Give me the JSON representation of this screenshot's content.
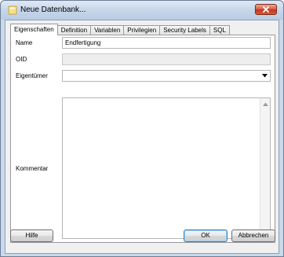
{
  "window": {
    "title": "Neue Datenbank...",
    "close_icon": "close-x-icon"
  },
  "tabs": [
    {
      "label": "Eigenschaften",
      "active": true
    },
    {
      "label": "Definition",
      "active": false
    },
    {
      "label": "Variablen",
      "active": false
    },
    {
      "label": "Privilegien",
      "active": false
    },
    {
      "label": "Security Labels",
      "active": false
    },
    {
      "label": "SQL",
      "active": false
    }
  ],
  "form": {
    "name_label": "Name",
    "name_value": "Endfertigung",
    "oid_label": "OID",
    "oid_value": "",
    "owner_label": "Eigentümer",
    "owner_value": "",
    "comment_label": "Kommentar",
    "comment_value": ""
  },
  "buttons": {
    "help": "Hilfe",
    "ok": "OK",
    "cancel": "Abbrechen"
  }
}
